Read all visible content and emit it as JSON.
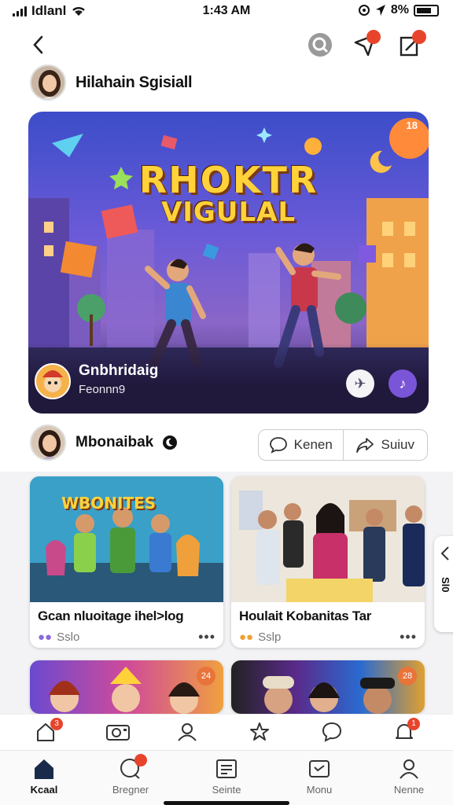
{
  "status_bar": {
    "carrier": "Idlanl",
    "time": "1:43 AM",
    "battery": "8%"
  },
  "header": {
    "back_icon": "chevron-left-icon",
    "actions": [
      "search-icon",
      "send-icon",
      "edit-icon"
    ]
  },
  "profile": {
    "name": "Hilahain Sgisiall"
  },
  "hero": {
    "title_line1": "RHOKTR",
    "title_line2": "VIGULAL",
    "caption_title": "Gnbhridaig",
    "caption_sub": "Feonnn9",
    "badge_text": "18"
  },
  "author": {
    "name": "Mbonaibak"
  },
  "actions": {
    "comment_label": "Kenen",
    "share_label": "Suiuv"
  },
  "cards": [
    {
      "banner": "WBONITES",
      "title": "Gcan nluoitage ihel>log",
      "meta": "Sslo"
    },
    {
      "banner": "",
      "title": "Houlait Kobanitas Tar",
      "meta": "Sslp"
    },
    {
      "banner": "",
      "title": "",
      "meta": "",
      "badge": "24"
    },
    {
      "banner": "",
      "title": "",
      "meta": "",
      "badge": "28"
    }
  ],
  "side_tab": {
    "text": "Sl0"
  },
  "toolbar": {
    "badges": [
      "3",
      "1"
    ]
  },
  "nav": {
    "items": [
      {
        "label": "Kcaal",
        "icon": "home-icon"
      },
      {
        "label": "Bregner",
        "icon": "chat-icon"
      },
      {
        "label": "Seinte",
        "icon": "document-icon"
      },
      {
        "label": "Monu",
        "icon": "message-icon"
      },
      {
        "label": "Nenne",
        "icon": "profile-icon"
      }
    ]
  },
  "colors": {
    "accent": "#e8442c",
    "hero_purple": "#6a5ad8",
    "hero_title": "#ffd23a",
    "music_button": "#7a55d8"
  }
}
